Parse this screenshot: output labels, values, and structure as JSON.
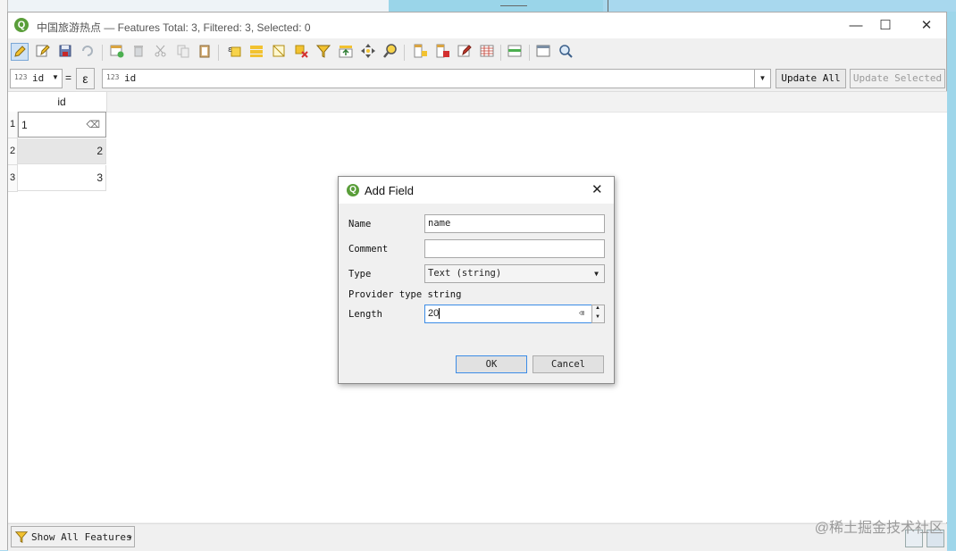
{
  "window": {
    "title": "中国旅游热点 — Features Total: 3, Filtered: 3, Selected: 0",
    "minimize_glyph": "—",
    "maximize_glyph": "☐",
    "close_glyph": "✕"
  },
  "expression_bar": {
    "field_type_badge": "123",
    "field_name": "id",
    "equals_label": "=",
    "epsilon_label": "ε",
    "expression_type_badge": "123",
    "expression_value": "id",
    "update_all_label": "Update All",
    "update_selected_label": "Update Selected"
  },
  "table": {
    "columns": [
      "id"
    ],
    "rows": [
      {
        "row_number": "1",
        "id": "1"
      },
      {
        "row_number": "2",
        "id": "2"
      },
      {
        "row_number": "3",
        "id": "3"
      }
    ]
  },
  "statusbar": {
    "filter_label": "Show All Features"
  },
  "dialog": {
    "title": "Add Field",
    "name_label": "Name",
    "name_value": "name",
    "comment_label": "Comment",
    "comment_value": "",
    "type_label": "Type",
    "type_value": "Text (string)",
    "provider_type_text": "Provider type string",
    "length_label": "Length",
    "length_value": "20",
    "ok_label": "OK",
    "cancel_label": "Cancel"
  },
  "watermark": "@稀土掘金技术社区",
  "colors": {
    "accent": "#3c8ce6",
    "qgis_green": "#5a9e3a",
    "map_water": "#a8d8ee"
  }
}
